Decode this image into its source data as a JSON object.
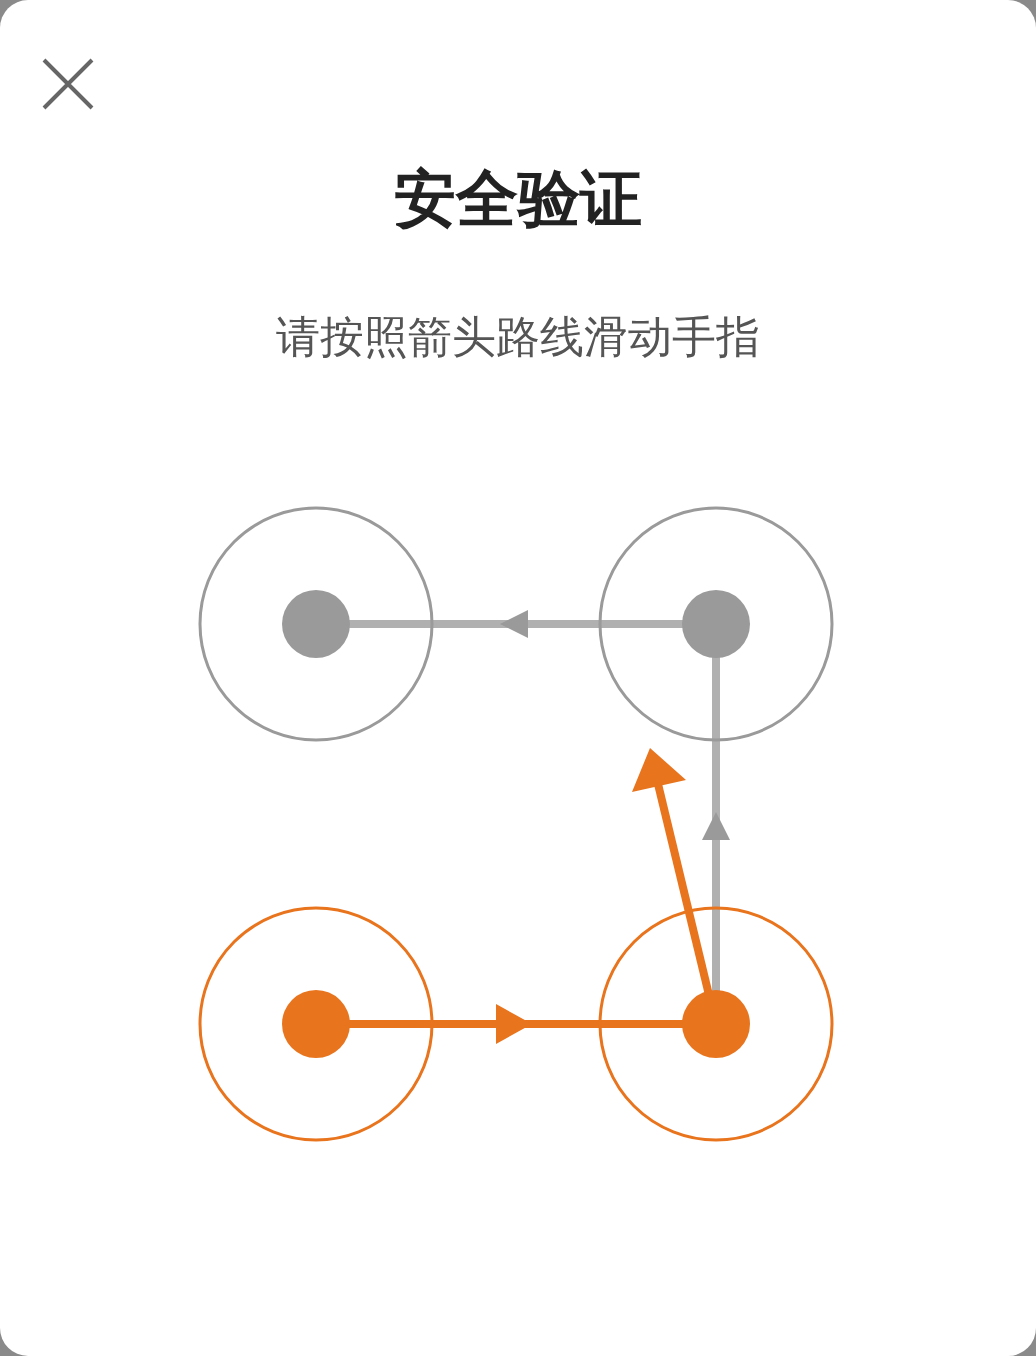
{
  "title": "安全验证",
  "subtitle": "请按照箭头路线滑动手指",
  "nodes": [
    {
      "active": false
    },
    {
      "active": false
    },
    {
      "active": true
    },
    {
      "active": true
    }
  ]
}
